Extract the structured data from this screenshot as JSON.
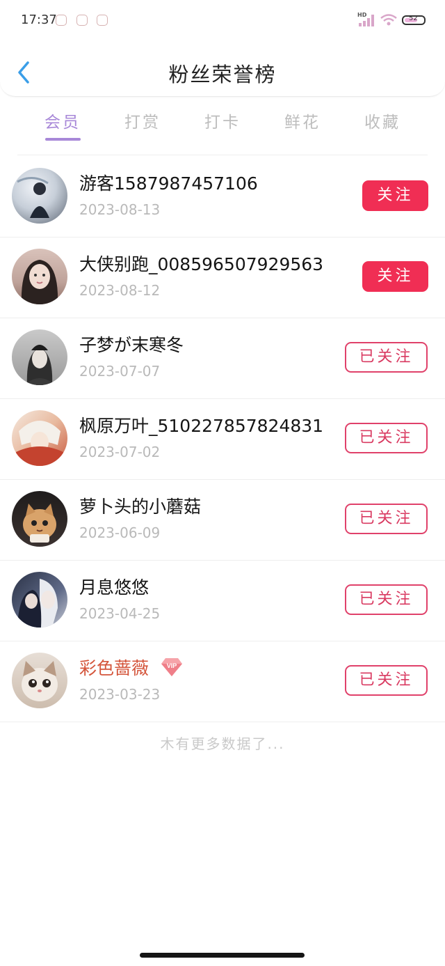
{
  "status": {
    "time": "17:37",
    "network": "HD",
    "battery": "52"
  },
  "header": {
    "title": "粉丝荣誉榜"
  },
  "tabs": [
    {
      "label": "会员",
      "active": true
    },
    {
      "label": "打赏",
      "active": false
    },
    {
      "label": "打卡",
      "active": false
    },
    {
      "label": "鲜花",
      "active": false
    },
    {
      "label": "收藏",
      "active": false
    }
  ],
  "fans": [
    {
      "name": "游客1587987457106",
      "date": "2023-08-13",
      "button": "关注"
    },
    {
      "name": "大侠别跑_008596507929563",
      "date": "2023-08-12",
      "button": "关注"
    },
    {
      "name": "子梦が末寒冬",
      "date": "2023-07-07",
      "button": "已关注"
    },
    {
      "name": "枫原万叶_510227857824831",
      "date": "2023-07-02",
      "button": "已关注"
    },
    {
      "name": "萝卜头的小蘑菇",
      "date": "2023-06-09",
      "button": "已关注"
    },
    {
      "name": "月息悠悠",
      "date": "2023-04-25",
      "button": "已关注"
    },
    {
      "name": "彩色蔷薇",
      "date": "2023-03-23",
      "button": "已关注",
      "vip_badge": "VIP"
    }
  ],
  "footer": {
    "no_more": "木有更多数据了..."
  },
  "colors": {
    "accent_tab": "#a888d8",
    "follow": "#f02e54",
    "followed_border": "#e0416a",
    "vip_name": "#d4553b",
    "back_arrow": "#3a9ee8"
  },
  "icons": {
    "back": "chevron-left-icon",
    "vip": "vip-diamond-icon"
  }
}
